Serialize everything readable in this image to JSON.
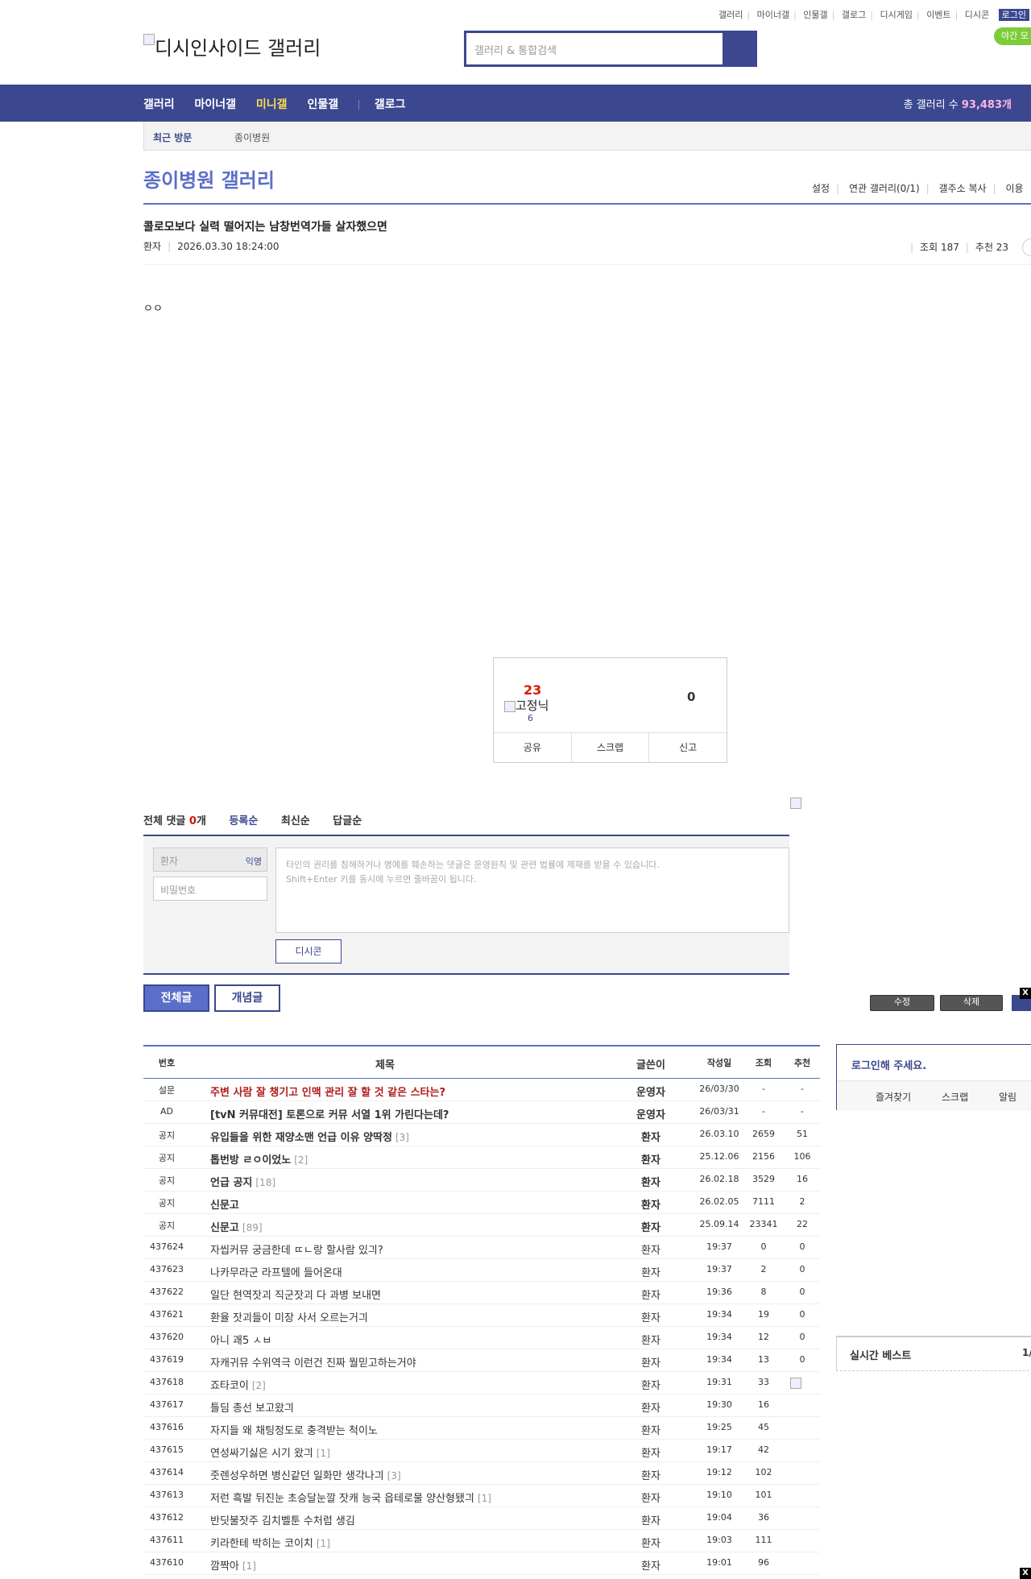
{
  "topnav": {
    "links": [
      "갤러리",
      "마이너갤",
      "인물갤",
      "갤로그",
      "디시게임",
      "이벤트",
      "디시콘"
    ],
    "login": "로그인"
  },
  "night_mode": "야간 모",
  "logo_alt": "디시인사이드 갤러리",
  "search": {
    "placeholder": "갤러리 & 통합검색"
  },
  "mainnav": {
    "items": [
      "갤러리",
      "마이너갤",
      "미니갤",
      "인물갤"
    ],
    "gallog": "갤로그",
    "count_label": "총 갤러리 수",
    "count_value": "93,483개"
  },
  "recent": {
    "title": "최근 방문",
    "item": "종이병원"
  },
  "gallery": {
    "title": "종이병원 갤러리",
    "links": [
      "설정",
      "연관 갤러리(0/1)",
      "갤주소 복사",
      "이용"
    ]
  },
  "post": {
    "title": "콜로모보다 실력 떨어지는 남창번역가들 살자했으면",
    "author": "환자",
    "date": "2026.03.30 18:24:00",
    "views": "조회 187",
    "recommend": "추천 23",
    "body": "ㅇㅇ"
  },
  "vote": {
    "up": "23",
    "img_alt": "고정닉",
    "fixed": "6",
    "down": "0",
    "share": "공유",
    "scrap": "스크랩",
    "report": "신고"
  },
  "comments": {
    "total_label": "전체 댓글",
    "count": "0",
    "unit": "개",
    "sort": [
      "등록순",
      "최신순",
      "답글순"
    ],
    "name_placeholder": "환자",
    "anon": "익명",
    "pw_placeholder": "비밀번호",
    "notice1": "타인의 권리를 침해하거나 명예를 훼손하는 댓글은 운영원칙 및 관련 법률에 제재를 받을 수 있습니다.",
    "notice2": "Shift+Enter 키를 동시에 누르면 줄바꿈이 됩니다.",
    "dccon": "디시콘"
  },
  "tabs": {
    "all": "전체글",
    "concept": "개념글"
  },
  "float_buttons": [
    "수정",
    "삭제"
  ],
  "close": "X",
  "list": {
    "headers": [
      "번호",
      "제목",
      "글쓴이",
      "작성일",
      "조회",
      "추천"
    ],
    "rows": [
      {
        "num": "설문",
        "subject": "주변 사람 잘 챙기고 인맥 관리 잘 할 것 같은 스타는?",
        "cnt": "",
        "writer": "운영자",
        "date": "26/03/30",
        "views": "-",
        "rec": "-",
        "style": "red bold"
      },
      {
        "num": "AD",
        "subject": "[tvN 커뮤대전] 토론으로 커뮤 서열 1위 가린다는데?",
        "cnt": "",
        "writer": "운영자",
        "date": "26/03/31",
        "views": "-",
        "rec": "-",
        "style": "bold"
      },
      {
        "num": "공지",
        "subject": "유입들을 위한 재양소맨 언급 이유 양딱정",
        "cnt": "[3]",
        "writer": "환자",
        "date": "26.03.10",
        "views": "2659",
        "rec": "51",
        "style": "bold"
      },
      {
        "num": "공지",
        "subject": "톱번방 ㄹㅇ이었노",
        "cnt": "[2]",
        "writer": "환자",
        "date": "25.12.06",
        "views": "2156",
        "rec": "106",
        "style": "bold"
      },
      {
        "num": "공지",
        "subject": "언급 공지",
        "cnt": "[18]",
        "writer": "환자",
        "date": "26.02.18",
        "views": "3529",
        "rec": "16",
        "style": "bold"
      },
      {
        "num": "공지",
        "subject": "신문고",
        "cnt": "",
        "writer": "환자",
        "date": "26.02.05",
        "views": "7111",
        "rec": "2",
        "style": "bold"
      },
      {
        "num": "공지",
        "subject": "신문고",
        "cnt": "[89]",
        "writer": "환자",
        "date": "25.09.14",
        "views": "23341",
        "rec": "22",
        "style": "bold"
      },
      {
        "num": "437624",
        "subject": "자씹커뮤 궁금한데 ㄸㄴ랑 할사람 있긔?",
        "cnt": "",
        "writer": "환자",
        "date": "19:37",
        "views": "0",
        "rec": "0",
        "style": ""
      },
      {
        "num": "437623",
        "subject": "나카무라군 라프텔에 들어온대",
        "cnt": "",
        "writer": "환자",
        "date": "19:37",
        "views": "2",
        "rec": "0",
        "style": ""
      },
      {
        "num": "437622",
        "subject": "일단 현역잣괴 직군잣괴 다 과병 보내면",
        "cnt": "",
        "writer": "환자",
        "date": "19:36",
        "views": "8",
        "rec": "0",
        "style": ""
      },
      {
        "num": "437621",
        "subject": "환율 잣괴들이 미장 사서 오르는거긔",
        "cnt": "",
        "writer": "환자",
        "date": "19:34",
        "views": "19",
        "rec": "0",
        "style": ""
      },
      {
        "num": "437620",
        "subject": "아니 괘5 ㅅㅂ",
        "cnt": "",
        "writer": "환자",
        "date": "19:34",
        "views": "12",
        "rec": "0",
        "style": ""
      },
      {
        "num": "437619",
        "subject": "자캐귀뮤 수위역극 이런건 진짜 뭘믿고하는거야",
        "cnt": "",
        "writer": "환자",
        "date": "19:34",
        "views": "13",
        "rec": "0",
        "style": ""
      },
      {
        "num": "437618",
        "subject": "죠타코이",
        "cnt": "[2]",
        "writer": "환자",
        "date": "19:31",
        "views": "33",
        "rec": "",
        "style": ""
      },
      {
        "num": "437617",
        "subject": "틀딤 총선 보고왔긔",
        "cnt": "",
        "writer": "환자",
        "date": "19:30",
        "views": "16",
        "rec": "",
        "style": ""
      },
      {
        "num": "437616",
        "subject": "자지들 왜 채팅정도로 충격받는 척이노",
        "cnt": "",
        "writer": "환자",
        "date": "19:25",
        "views": "45",
        "rec": "",
        "style": ""
      },
      {
        "num": "437615",
        "subject": "연성싸기싫은 시기 왔긔",
        "cnt": "[1]",
        "writer": "환자",
        "date": "19:17",
        "views": "42",
        "rec": "",
        "style": ""
      },
      {
        "num": "437614",
        "subject": "줏렌성우하면 병신같던 일화만 생각나긔",
        "cnt": "[3]",
        "writer": "환자",
        "date": "19:12",
        "views": "102",
        "rec": "",
        "style": ""
      },
      {
        "num": "437613",
        "subject": "저런 흑발 뒤진눈 초승달눈깔 잣캐 능국 읍테로물 양산형됐긔",
        "cnt": "[1]",
        "writer": "환자",
        "date": "19:10",
        "views": "101",
        "rec": "",
        "style": ""
      },
      {
        "num": "437612",
        "subject": "반딧불잣주 김치벨툰 수처럼 생김",
        "cnt": "",
        "writer": "환자",
        "date": "19:04",
        "views": "36",
        "rec": "",
        "style": ""
      },
      {
        "num": "437611",
        "subject": "키라한테 박히는 코이치",
        "cnt": "[1]",
        "writer": "환자",
        "date": "19:03",
        "views": "111",
        "rec": "",
        "style": ""
      },
      {
        "num": "437610",
        "subject": "깜짝아",
        "cnt": "[1]",
        "writer": "환자",
        "date": "19:01",
        "views": "96",
        "rec": "",
        "style": ""
      }
    ]
  },
  "login_box": {
    "title": "로그인해 주세요.",
    "links": [
      "즐겨찾기",
      "스크랩",
      "알림"
    ]
  },
  "best": {
    "title": "실시간 베스트",
    "page": "1/"
  }
}
